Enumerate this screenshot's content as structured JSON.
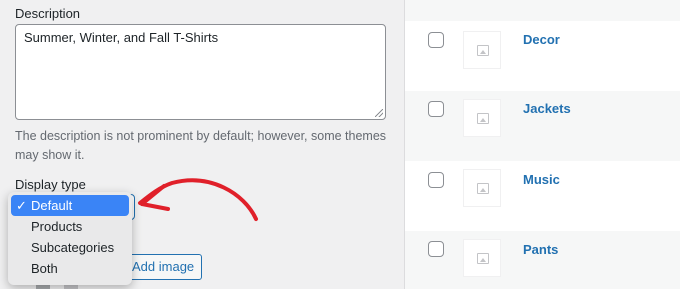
{
  "form": {
    "description_label": "Description",
    "description_value": "Summer, Winter, and Fall T-Shirts",
    "description_help": "The description is not prominent by default; however, some themes may show it.",
    "display_type_label": "Display type",
    "display_type_options": [
      "Default",
      "Products",
      "Subcategories",
      "Both"
    ],
    "display_type_selected": "Default",
    "add_image_label": "Add image"
  },
  "categories": [
    {
      "name": "Decor"
    },
    {
      "name": "Jackets"
    },
    {
      "name": "Music"
    },
    {
      "name": "Pants"
    }
  ],
  "colors": {
    "accent": "#2271b1",
    "selection": "#3a84f6",
    "annotation": "#e0202a"
  }
}
